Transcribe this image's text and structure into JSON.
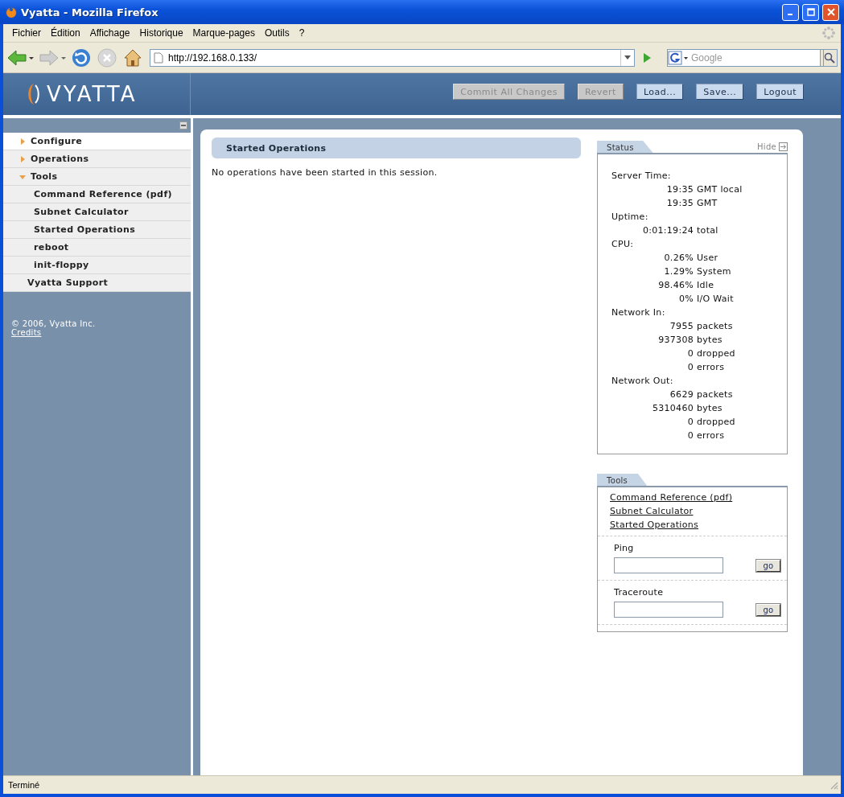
{
  "window": {
    "title": "Vyatta - Mozilla Firefox"
  },
  "menu": [
    "Fichier",
    "Édition",
    "Affichage",
    "Historique",
    "Marque-pages",
    "Outils",
    "?"
  ],
  "address": {
    "value": "http://192.168.0.133/"
  },
  "search": {
    "placeholder": "Google"
  },
  "header": {
    "logo": "VYATTA",
    "buttons": [
      {
        "label": "Commit All Changes",
        "disabled": true
      },
      {
        "label": "Revert",
        "disabled": true
      },
      {
        "label": "Load...",
        "disabled": false
      },
      {
        "label": "Save...",
        "disabled": false
      },
      {
        "label": "Logout",
        "disabled": false
      }
    ]
  },
  "sidebar": {
    "items": [
      {
        "label": "Configure",
        "kind": "section",
        "expanded": false,
        "selected": true
      },
      {
        "label": "Operations",
        "kind": "section",
        "expanded": false,
        "selected": false
      },
      {
        "label": "Tools",
        "kind": "section",
        "expanded": true,
        "selected": false,
        "children": [
          {
            "label": "Command Reference (pdf)",
            "selected": false
          },
          {
            "label": "Subnet Calculator",
            "selected": false
          },
          {
            "label": "Started Operations",
            "selected": false
          },
          {
            "label": "reboot",
            "selected": false
          },
          {
            "label": "init-floppy",
            "selected": false
          }
        ]
      },
      {
        "label": "Vyatta Support",
        "kind": "link",
        "selected": false
      }
    ],
    "copyright": "© 2006, Vyatta Inc.",
    "credits": "Credits"
  },
  "main": {
    "heading": "Started Operations",
    "message": "No operations have been started in this session."
  },
  "status_panel": {
    "tab": "Status",
    "hide": "Hide",
    "groups": [
      {
        "label": "Server Time:",
        "rows": [
          {
            "value": "19:35",
            "unit": "GMT local"
          },
          {
            "value": "19:35",
            "unit": "GMT"
          }
        ]
      },
      {
        "label": "Uptime:",
        "rows": [
          {
            "value": "0:01:19:24",
            "unit": "total"
          }
        ]
      },
      {
        "label": "CPU:",
        "rows": [
          {
            "value": "0.26%",
            "unit": "User"
          },
          {
            "value": "1.29%",
            "unit": "System"
          },
          {
            "value": "98.46%",
            "unit": "Idle"
          },
          {
            "value": "0%",
            "unit": "I/O Wait"
          }
        ]
      },
      {
        "label": "Network In:",
        "rows": [
          {
            "value": "7955",
            "unit": "packets"
          },
          {
            "value": "937308",
            "unit": "bytes"
          },
          {
            "value": "0",
            "unit": "dropped"
          },
          {
            "value": "0",
            "unit": "errors"
          }
        ]
      },
      {
        "label": "Network Out:",
        "rows": [
          {
            "value": "6629",
            "unit": "packets"
          },
          {
            "value": "5310460",
            "unit": "bytes"
          },
          {
            "value": "0",
            "unit": "dropped"
          },
          {
            "value": "0",
            "unit": "errors"
          }
        ]
      }
    ]
  },
  "tools_panel": {
    "tab": "Tools",
    "links": [
      "Command Reference (pdf)",
      "Subnet Calculator",
      "Started Operations"
    ],
    "forms": [
      {
        "label": "Ping",
        "button": "go"
      },
      {
        "label": "Traceroute",
        "button": "go"
      }
    ]
  },
  "status_bar": {
    "text": "Terminé"
  }
}
